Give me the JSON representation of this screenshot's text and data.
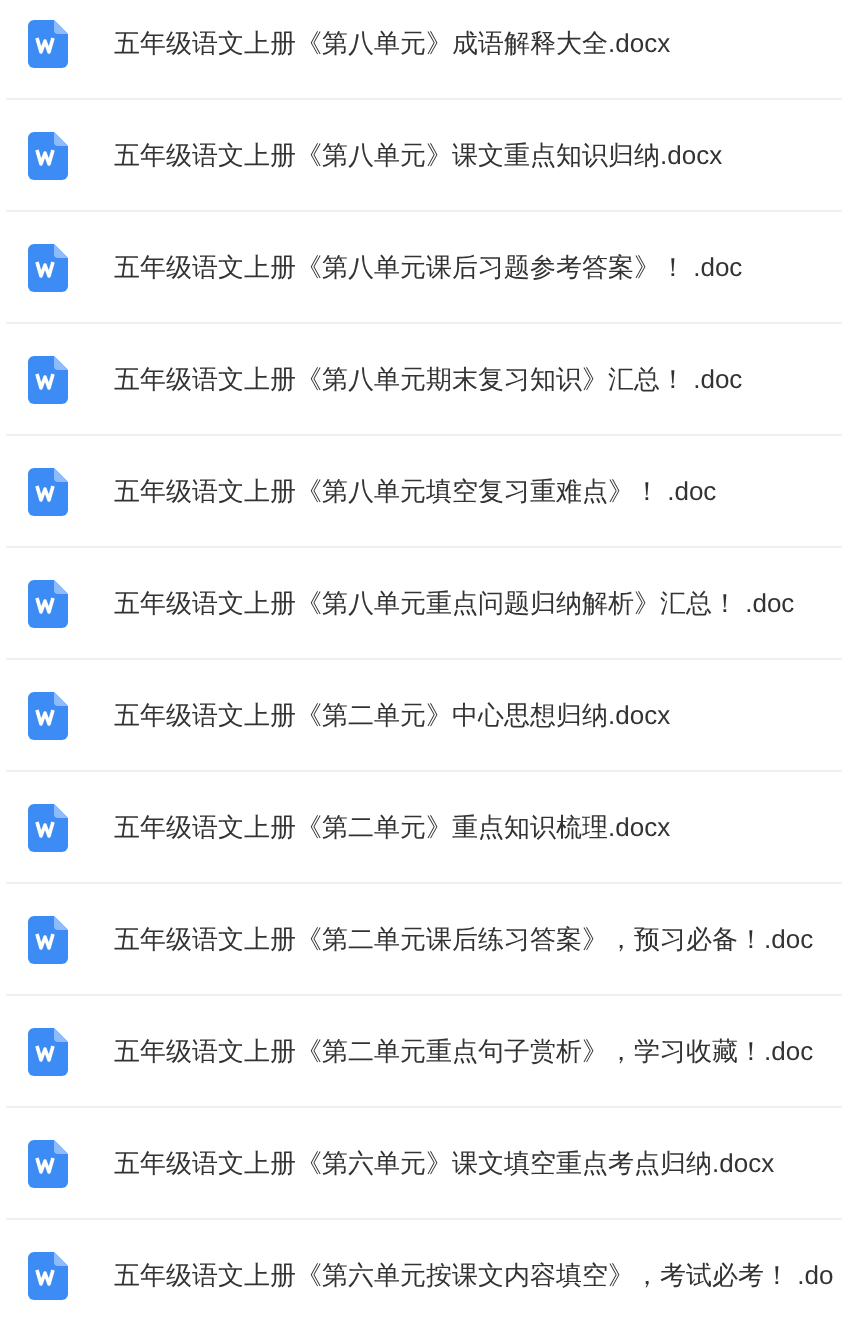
{
  "files": [
    {
      "name": "五年级语文上册《第八单元》成语解释大全.docx",
      "kind": "word"
    },
    {
      "name": "五年级语文上册《第八单元》课文重点知识归纳.docx",
      "kind": "word"
    },
    {
      "name": "五年级语文上册《第八单元课后习题参考答案》！ .doc",
      "kind": "word"
    },
    {
      "name": "五年级语文上册《第八单元期末复习知识》汇总！ .doc",
      "kind": "word"
    },
    {
      "name": "五年级语文上册《第八单元填空复习重难点》！ .doc",
      "kind": "word"
    },
    {
      "name": "五年级语文上册《第八单元重点问题归纳解析》汇总！ .doc",
      "kind": "word"
    },
    {
      "name": "五年级语文上册《第二单元》中心思想归纳.docx",
      "kind": "word"
    },
    {
      "name": "五年级语文上册《第二单元》重点知识梳理.docx",
      "kind": "word"
    },
    {
      "name": "五年级语文上册《第二单元课后练习答案》，预习必备！.doc",
      "kind": "word"
    },
    {
      "name": "五年级语文上册《第二单元重点句子赏析》，学习收藏！.doc",
      "kind": "word"
    },
    {
      "name": "五年级语文上册《第六单元》课文填空重点考点归纳.docx",
      "kind": "word"
    },
    {
      "name": "五年级语文上册《第六单元按课文内容填空》，考试必考！ .do",
      "kind": "word"
    }
  ]
}
